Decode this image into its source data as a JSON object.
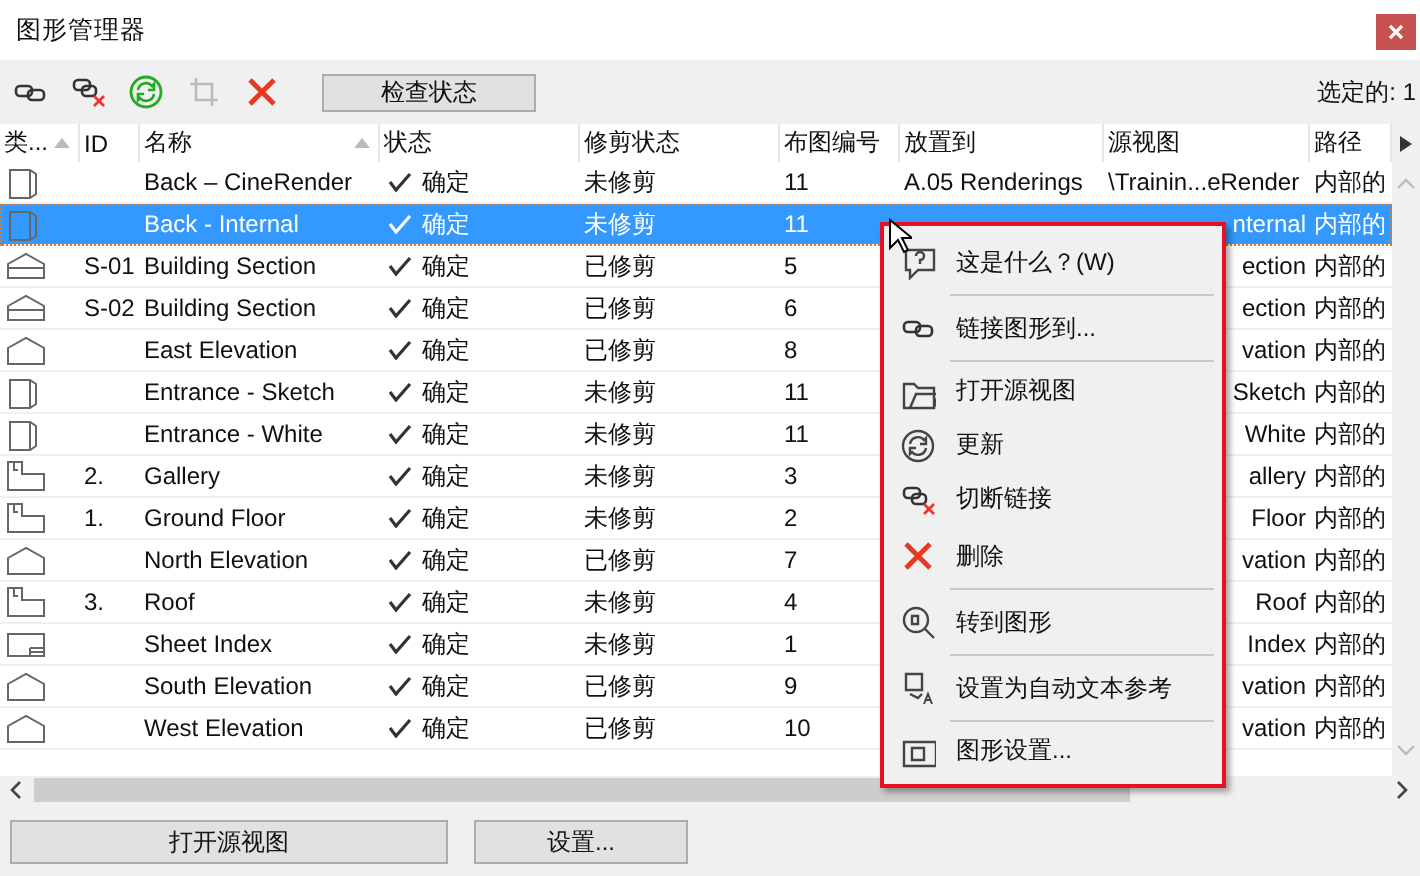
{
  "window": {
    "title": "图形管理器"
  },
  "toolbar": {
    "check_button": "检查状态",
    "selection_count": "选定的: 1"
  },
  "table": {
    "columns": [
      {
        "label": "类...",
        "sorted": true
      },
      {
        "label": "ID",
        "sorted": false
      },
      {
        "label": "名称",
        "sorted": true
      },
      {
        "label": "状态",
        "sorted": false
      },
      {
        "label": "修剪状态",
        "sorted": false
      },
      {
        "label": "布图编号",
        "sorted": false
      },
      {
        "label": "放置到",
        "sorted": false
      },
      {
        "label": "源视图",
        "sorted": false
      },
      {
        "label": "路径",
        "sorted": false
      }
    ],
    "rows": [
      {
        "kind": "perspective",
        "id": "",
        "name": "Back – CineRender",
        "status": "确定",
        "trim": "未修剪",
        "layout_no": "11",
        "placed": "A.05 Renderings",
        "source": "\\Trainin...eRender",
        "path": "内部的",
        "selected": false
      },
      {
        "kind": "perspective",
        "id": "",
        "name": "Back - Internal",
        "status": "确定",
        "trim": "未修剪",
        "layout_no": "11",
        "source": "nternal",
        "path": "内部的",
        "selected": true
      },
      {
        "kind": "section",
        "id": "S-01",
        "name": "Building Section",
        "status": "确定",
        "trim": "已修剪",
        "layout_no": "5",
        "source": "ection",
        "path": "内部的",
        "selected": false
      },
      {
        "kind": "section",
        "id": "S-02",
        "name": "Building Section",
        "status": "确定",
        "trim": "已修剪",
        "layout_no": "6",
        "source": "ection",
        "path": "内部的",
        "selected": false
      },
      {
        "kind": "elevation",
        "id": "",
        "name": "East Elevation",
        "status": "确定",
        "trim": "已修剪",
        "layout_no": "8",
        "source": "vation",
        "path": "内部的",
        "selected": false
      },
      {
        "kind": "perspective",
        "id": "",
        "name": "Entrance - Sketch",
        "status": "确定",
        "trim": "未修剪",
        "layout_no": "11",
        "source": "Sketch",
        "path": "内部的",
        "selected": false
      },
      {
        "kind": "perspective",
        "id": "",
        "name": "Entrance - White",
        "status": "确定",
        "trim": "未修剪",
        "layout_no": "11",
        "source": "White",
        "path": "内部的",
        "selected": false
      },
      {
        "kind": "plan",
        "id": "2.",
        "name": "Gallery",
        "status": "确定",
        "trim": "未修剪",
        "layout_no": "3",
        "source": "allery",
        "path": "内部的",
        "selected": false
      },
      {
        "kind": "plan",
        "id": "1.",
        "name": "Ground Floor",
        "status": "确定",
        "trim": "未修剪",
        "layout_no": "2",
        "source": "Floor",
        "path": "内部的",
        "selected": false
      },
      {
        "kind": "elevation",
        "id": "",
        "name": "North Elevation",
        "status": "确定",
        "trim": "已修剪",
        "layout_no": "7",
        "source": "vation",
        "path": "内部的",
        "selected": false
      },
      {
        "kind": "plan",
        "id": "3.",
        "name": "Roof",
        "status": "确定",
        "trim": "未修剪",
        "layout_no": "4",
        "source": "Roof",
        "path": "内部的",
        "selected": false
      },
      {
        "kind": "sheet",
        "id": "",
        "name": "Sheet Index",
        "status": "确定",
        "trim": "未修剪",
        "layout_no": "1",
        "source": "Index",
        "path": "内部的",
        "selected": false
      },
      {
        "kind": "elevation",
        "id": "",
        "name": "South Elevation",
        "status": "确定",
        "trim": "已修剪",
        "layout_no": "9",
        "source": "vation",
        "path": "内部的",
        "selected": false
      },
      {
        "kind": "elevation",
        "id": "",
        "name": "West Elevation",
        "status": "确定",
        "trim": "已修剪",
        "layout_no": "10",
        "source": "vation",
        "path": "内部的",
        "selected": false
      }
    ]
  },
  "context_menu": {
    "items": [
      {
        "kind": "help",
        "label": "这是什么？(W)",
        "separator_after": true
      },
      {
        "kind": "link",
        "label": "链接图形到...",
        "separator_after": true
      },
      {
        "kind": "open",
        "label": "打开源视图",
        "separator_after": false
      },
      {
        "kind": "update",
        "label": "更新",
        "separator_after": false
      },
      {
        "kind": "unlink",
        "label": "切断链接",
        "separator_after": false
      },
      {
        "kind": "delete",
        "label": "删除",
        "separator_after": true
      },
      {
        "kind": "goto",
        "label": "转到图形",
        "separator_after": true
      },
      {
        "kind": "autotext",
        "label": "设置为自动文本参考",
        "separator_after": true
      },
      {
        "kind": "settings",
        "label": "图形设置...",
        "separator_after": false
      }
    ]
  },
  "footer": {
    "buttons": [
      "打开源视图",
      "设置..."
    ]
  }
}
